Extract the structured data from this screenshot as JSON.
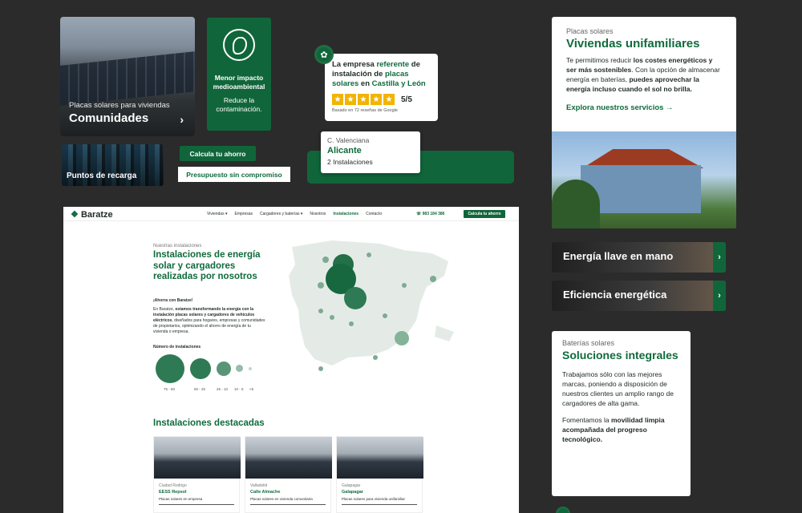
{
  "comunidades": {
    "subtitle": "Placas solares para viviendas",
    "title": "Comunidades",
    "chevron": "›"
  },
  "impacto": {
    "title": "Menor impacto medioambiental",
    "text": "Reduce la contaminación."
  },
  "rating": {
    "text_pre": "La empresa ",
    "text_highlight": "referente",
    "text_mid": " de instalación de ",
    "text_highlight2": "placas solares",
    "text_mid2": " en ",
    "text_highlight3": "Castilla y León",
    "score": "5/5",
    "based": "Basado en 72 reseñas de Google",
    "star": "★"
  },
  "alicante": {
    "region": "C. Valenciana",
    "city": "Alicante",
    "count": "2 Instalaciones"
  },
  "recarga": {
    "title": "Puntos de recarga"
  },
  "buttons": {
    "calcula": "Calcula tu ahorro",
    "presupuesto": "Presupuesto sin compromiso"
  },
  "viviendas": {
    "eyebrow": "Placas solares",
    "title": "Viviendas unifamiliares",
    "p1": "Te permitimos reducir ",
    "p1b": "los costes energéticos y ser más sostenibles",
    "p1c": ". Con la opción de almacenar energía en baterías, ",
    "p1d": "puedes aprovechar la energía incluso cuando el sol no brilla.",
    "link": "Explora nuestros servicios →"
  },
  "bars": [
    {
      "label": "Energía llave en mano",
      "arrow": "›"
    },
    {
      "label": "Eficiencia energética",
      "arrow": "›"
    }
  ],
  "baterias": {
    "eyebrow": "Baterías solares",
    "title": "Soluciones integrales",
    "p1": "Trabajamos sólo con las mejores marcas, poniendo a disposición de nuestros clientes un amplio rango de cargadores de alta gama.",
    "p2a": "Fomentamos la ",
    "p2b": "movilidad limpia acompañada del progreso tecnológico."
  },
  "site": {
    "logo": "Baratze",
    "nav": [
      "Viviendas ▾",
      "Empresas",
      "Cargadores y baterías ▾",
      "Nosotros",
      "Instalaciones",
      "Contacto"
    ],
    "phone": "983 184 386",
    "nav_button": "Calcula tu ahorro",
    "eyebrow": "Nuestras instalaciones",
    "title": "Instalaciones de energía solar y cargadores realizadas por nosotros",
    "ahorro": "¡Ahorra con Baratze!",
    "desc_a": "En Baratze, ",
    "desc_b": "estamos transformando la energía con la instalación placas solares y cargadores de vehículos eléctricos",
    "desc_c": ", diseñados para hogares, empresas y comunidades de propietarios, optimizando el ahorro de energía de tu vivienda o empresa.",
    "num_label": "Número de instalaciones",
    "legend": [
      "75 - 50",
      "50 - 25",
      "25 - 10",
      "10 - 5",
      "<5"
    ],
    "destacadas_title": "Instalaciones destacadas",
    "destacadas": [
      {
        "ciudad": "Ciudad Rodrigo",
        "nombre": "EESS Repsol",
        "tipo": "Placas solares en empresa"
      },
      {
        "ciudad": "Valladolid",
        "nombre": "Calle Almache",
        "tipo": "Placas solares en vivienda comunitaria"
      },
      {
        "ciudad": "Galapagar",
        "nombre": "Galapagar",
        "tipo": "Placas solares para vivienda unifamiliar"
      }
    ]
  }
}
